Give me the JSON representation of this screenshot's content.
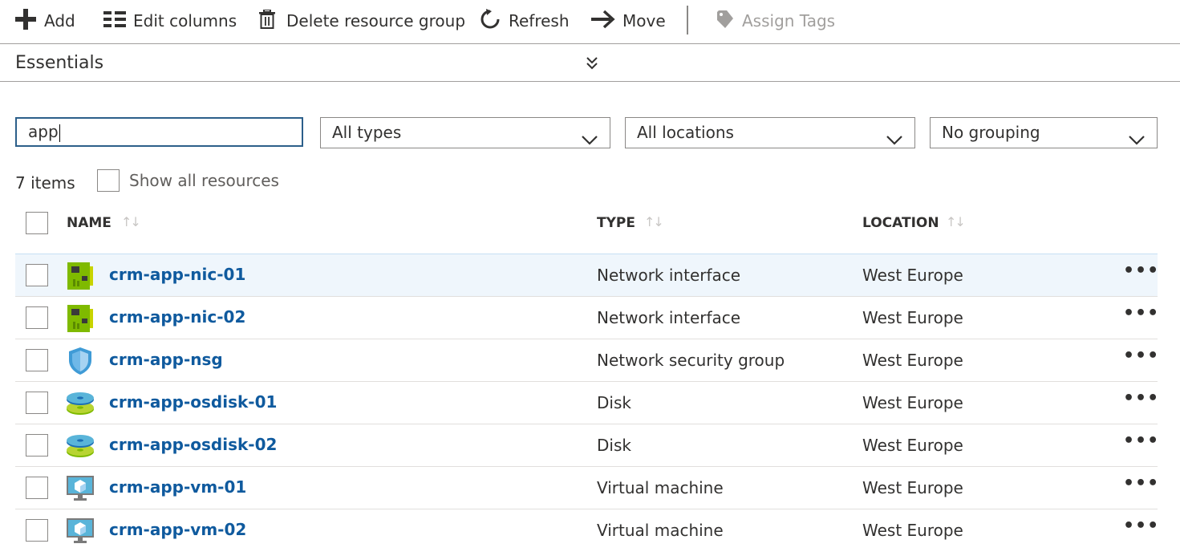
{
  "toolbar": {
    "add": "Add",
    "edit_columns": "Edit columns",
    "delete_group": "Delete resource group",
    "refresh": "Refresh",
    "move": "Move",
    "assign_tags": "Assign Tags"
  },
  "essentials": {
    "label": "Essentials"
  },
  "filters": {
    "search_value": "app",
    "type": "All types",
    "location": "All locations",
    "grouping": "No grouping"
  },
  "summary": {
    "count": "7 items",
    "show_all": "Show all resources"
  },
  "columns": {
    "name": "NAME",
    "type": "TYPE",
    "location": "LOCATION"
  },
  "rows": [
    {
      "name": "crm-app-nic-01",
      "type": "Network interface",
      "location": "West Europe",
      "icon": "network-interface-icon"
    },
    {
      "name": "crm-app-nic-02",
      "type": "Network interface",
      "location": "West Europe",
      "icon": "network-interface-icon"
    },
    {
      "name": "crm-app-nsg",
      "type": "Network security group",
      "location": "West Europe",
      "icon": "network-security-group-icon"
    },
    {
      "name": "crm-app-osdisk-01",
      "type": "Disk",
      "location": "West Europe",
      "icon": "disk-icon"
    },
    {
      "name": "crm-app-osdisk-02",
      "type": "Disk",
      "location": "West Europe",
      "icon": "disk-icon"
    },
    {
      "name": "crm-app-vm-01",
      "type": "Virtual machine",
      "location": "West Europe",
      "icon": "virtual-machine-icon"
    },
    {
      "name": "crm-app-vm-02",
      "type": "Virtual machine",
      "location": "West Europe",
      "icon": "virtual-machine-icon"
    }
  ],
  "colors": {
    "link": "#0f5a9e",
    "row_highlight": "#eff6fc",
    "search_border": "#2c5f8a"
  }
}
